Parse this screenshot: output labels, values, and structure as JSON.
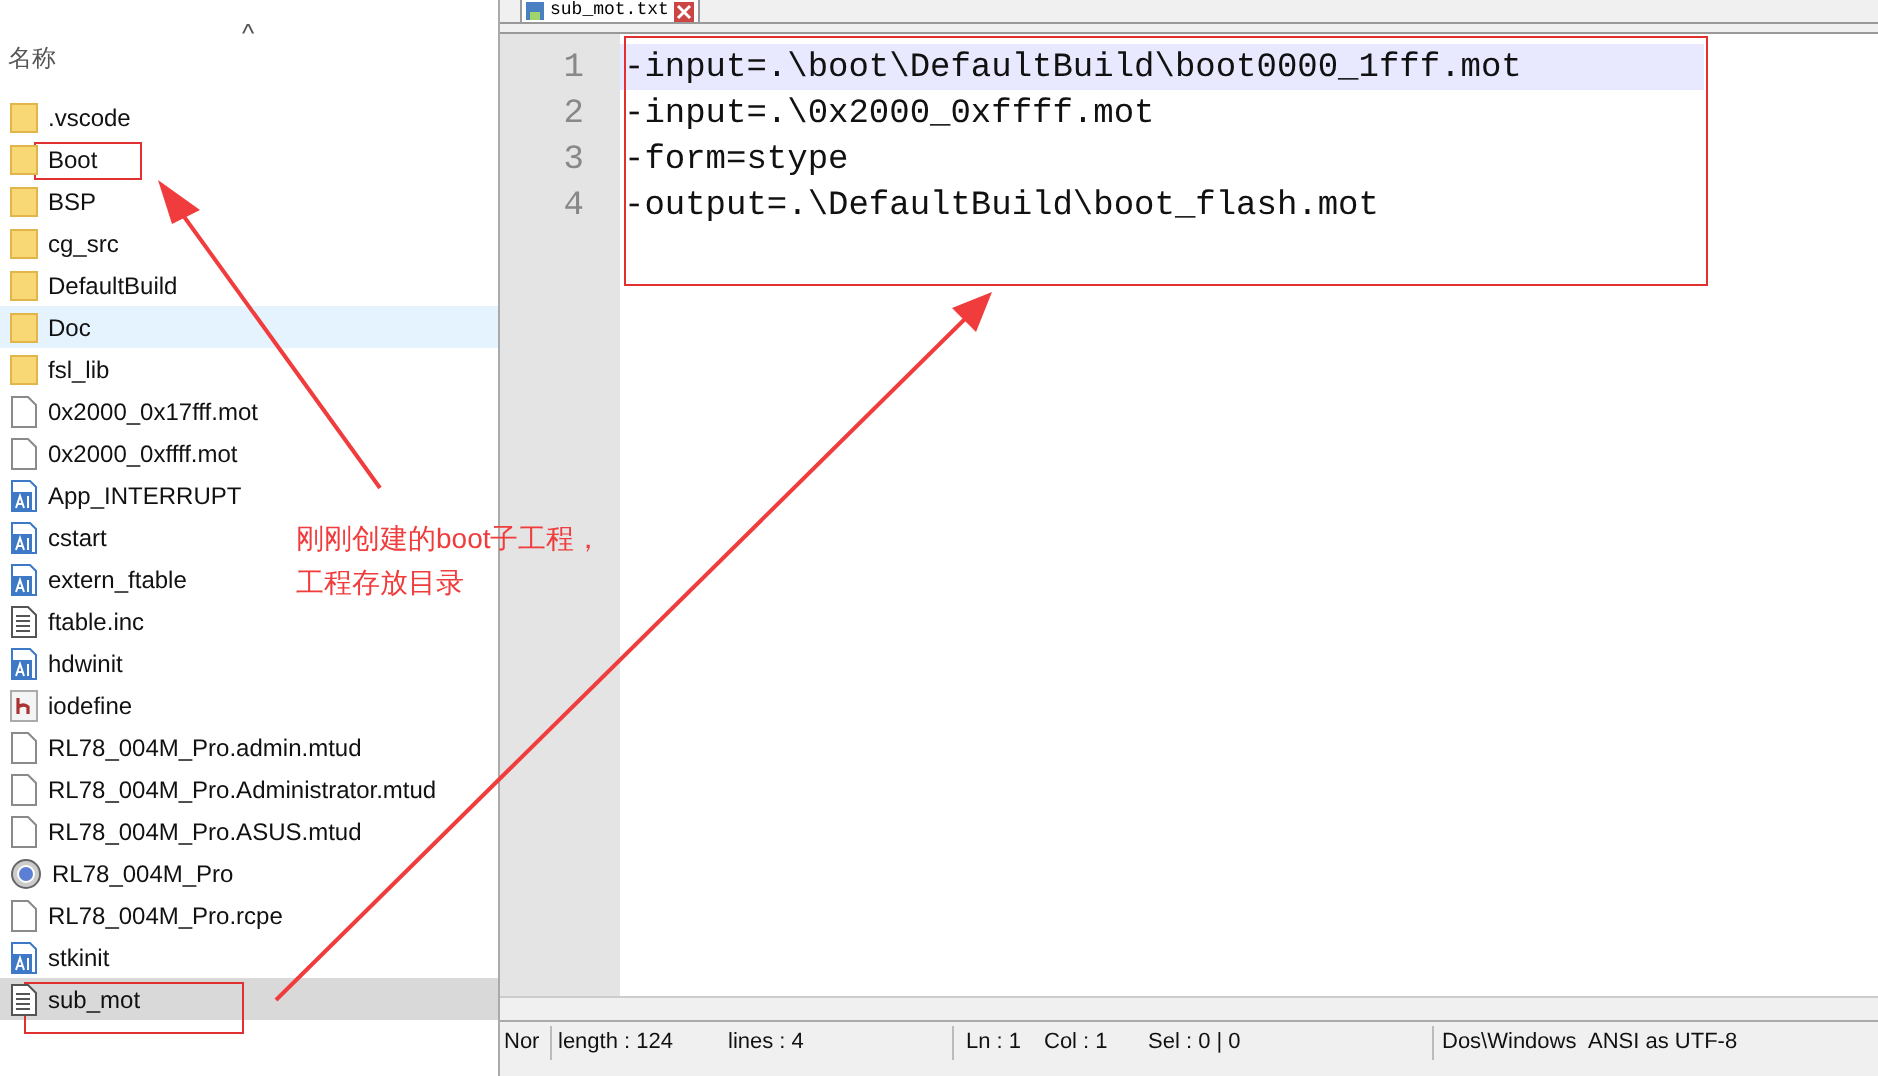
{
  "explorer": {
    "column_header": "名称",
    "sort_caret": "^",
    "items": [
      {
        "name": ".vscode",
        "kind": "folder",
        "selected": false,
        "hovered": false,
        "boxed": false
      },
      {
        "name": "Boot",
        "kind": "folder",
        "selected": false,
        "hovered": false,
        "boxed": true
      },
      {
        "name": "BSP",
        "kind": "folder",
        "selected": false,
        "hovered": false,
        "boxed": false
      },
      {
        "name": "cg_src",
        "kind": "folder",
        "selected": false,
        "hovered": false,
        "boxed": false
      },
      {
        "name": "DefaultBuild",
        "kind": "folder",
        "selected": false,
        "hovered": false,
        "boxed": false
      },
      {
        "name": "Doc",
        "kind": "folder",
        "selected": false,
        "hovered": true,
        "boxed": false
      },
      {
        "name": "fsl_lib",
        "kind": "folder",
        "selected": false,
        "hovered": false,
        "boxed": false
      },
      {
        "name": "0x2000_0x17fff.mot",
        "kind": "file",
        "selected": false,
        "hovered": false,
        "boxed": false
      },
      {
        "name": "0x2000_0xffff.mot",
        "kind": "file",
        "selected": false,
        "hovered": false,
        "boxed": false
      },
      {
        "name": "App_INTERRUPT",
        "kind": "asm",
        "selected": false,
        "hovered": false,
        "boxed": false
      },
      {
        "name": "cstart",
        "kind": "asm",
        "selected": false,
        "hovered": false,
        "boxed": false
      },
      {
        "name": "extern_ftable",
        "kind": "asm",
        "selected": false,
        "hovered": false,
        "boxed": false
      },
      {
        "name": "ftable.inc",
        "kind": "text",
        "selected": false,
        "hovered": false,
        "boxed": false
      },
      {
        "name": "hdwinit",
        "kind": "asm",
        "selected": false,
        "hovered": false,
        "boxed": false
      },
      {
        "name": "iodefine",
        "kind": "header",
        "selected": false,
        "hovered": false,
        "boxed": false
      },
      {
        "name": "RL78_004M_Pro.admin.mtud",
        "kind": "file",
        "selected": false,
        "hovered": false,
        "boxed": false
      },
      {
        "name": "RL78_004M_Pro.Administrator.mtud",
        "kind": "file",
        "selected": false,
        "hovered": false,
        "boxed": false
      },
      {
        "name": "RL78_004M_Pro.ASUS.mtud",
        "kind": "file",
        "selected": false,
        "hovered": false,
        "boxed": false
      },
      {
        "name": "RL78_004M_Pro",
        "kind": "project",
        "selected": false,
        "hovered": false,
        "boxed": false
      },
      {
        "name": "RL78_004M_Pro.rcpe",
        "kind": "file",
        "selected": false,
        "hovered": false,
        "boxed": false
      },
      {
        "name": "stkinit",
        "kind": "asm",
        "selected": false,
        "hovered": false,
        "boxed": false
      },
      {
        "name": "sub_mot",
        "kind": "text",
        "selected": true,
        "hovered": false,
        "boxed": true
      }
    ]
  },
  "editor": {
    "tab": {
      "label": "sub_mot.txt",
      "selected": true
    },
    "lines": [
      {
        "number": "1",
        "text": "-input=.\\boot\\DefaultBuild\\boot0000_1fff.mot",
        "current": true
      },
      {
        "number": "2",
        "text": "-input=.\\0x2000_0xffff.mot",
        "current": false
      },
      {
        "number": "3",
        "text": "-form=stype",
        "current": false
      },
      {
        "number": "4",
        "text": "-output=.\\DefaultBuild\\boot_flash.mot",
        "current": false
      }
    ],
    "status_bar": [
      "Nor",
      "length : 124",
      "lines : 4",
      "Ln : 1",
      "Col : 1",
      "Sel : 0 | 0",
      "Dos\\Windows",
      "ANSI as UTF-8"
    ]
  },
  "annotation": {
    "lines": [
      "刚刚创建的boot子工程，",
      "工程存放目录"
    ]
  }
}
